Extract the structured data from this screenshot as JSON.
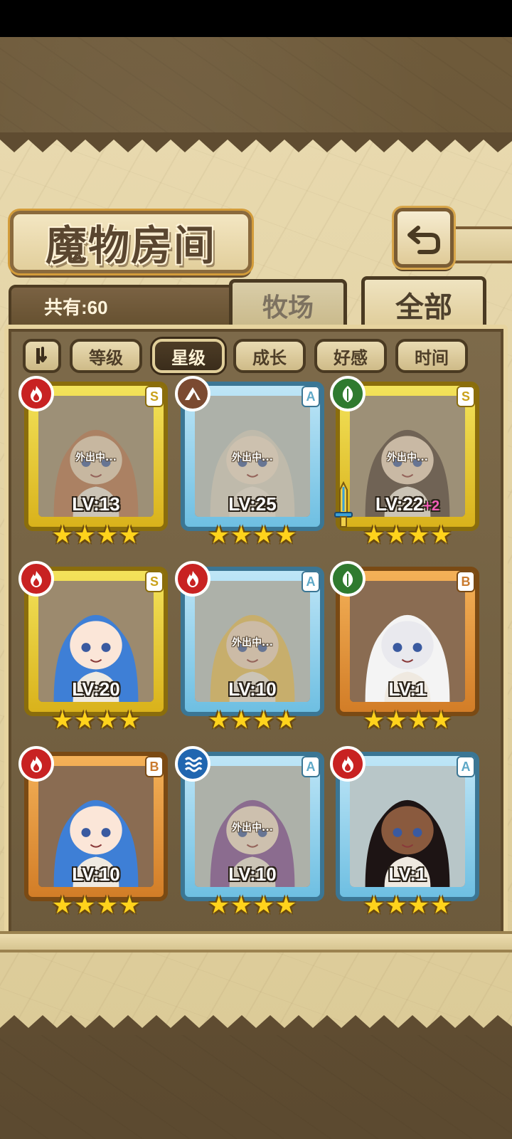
{
  "header": {
    "title": "魔物房间",
    "back_icon": "return-arrow-icon"
  },
  "summary": {
    "count_text": "共有:60"
  },
  "tabs": [
    {
      "label": "牧场",
      "active": false
    },
    {
      "label": "全部",
      "active": true
    }
  ],
  "filters": {
    "toggle_icon": "sort-toggle-icon",
    "items": [
      {
        "label": "等级",
        "active": false
      },
      {
        "label": "星级",
        "active": true
      },
      {
        "label": "成长",
        "active": false
      },
      {
        "label": "好感",
        "active": false
      },
      {
        "label": "时间",
        "active": false
      }
    ]
  },
  "cards": [
    {
      "element": "fire",
      "rank": "S",
      "frame": "gold",
      "level": "LV:13",
      "bonus": "",
      "stars": 4,
      "away": true,
      "away_text": "外出中..."
    },
    {
      "element": "earth",
      "rank": "A",
      "frame": "blue",
      "level": "LV:25",
      "bonus": "",
      "stars": 4,
      "away": true,
      "away_text": "外出中..."
    },
    {
      "element": "leaf",
      "rank": "S",
      "frame": "gold",
      "level": "LV:22",
      "bonus": "+2",
      "stars": 4,
      "away": true,
      "away_text": "外出中...",
      "weapon_icon": "sword-icon"
    },
    {
      "element": "fire",
      "rank": "S",
      "frame": "gold",
      "level": "LV:20",
      "bonus": "",
      "stars": 4,
      "away": false,
      "away_text": ""
    },
    {
      "element": "fire",
      "rank": "A",
      "frame": "blue",
      "level": "LV:10",
      "bonus": "",
      "stars": 4,
      "away": true,
      "away_text": "外出中..."
    },
    {
      "element": "leaf",
      "rank": "B",
      "frame": "orange",
      "level": "LV:1",
      "bonus": "",
      "stars": 4,
      "away": false,
      "away_text": ""
    },
    {
      "element": "fire",
      "rank": "B",
      "frame": "orange",
      "level": "LV:10",
      "bonus": "",
      "stars": 4,
      "away": false,
      "away_text": ""
    },
    {
      "element": "water",
      "rank": "A",
      "frame": "blue",
      "level": "LV:10",
      "bonus": "",
      "stars": 4,
      "away": true,
      "away_text": "外出中..."
    },
    {
      "element": "fire",
      "rank": "A",
      "frame": "blue",
      "level": "LV:1",
      "bonus": "",
      "stars": 4,
      "away": false,
      "away_text": ""
    }
  ],
  "colors": {
    "gold_frame": "#e8c92a",
    "blue_frame": "#8fd0ee",
    "orange_frame": "#e39a3d",
    "star": "#ffd31c",
    "bonus": "#f35db9"
  }
}
